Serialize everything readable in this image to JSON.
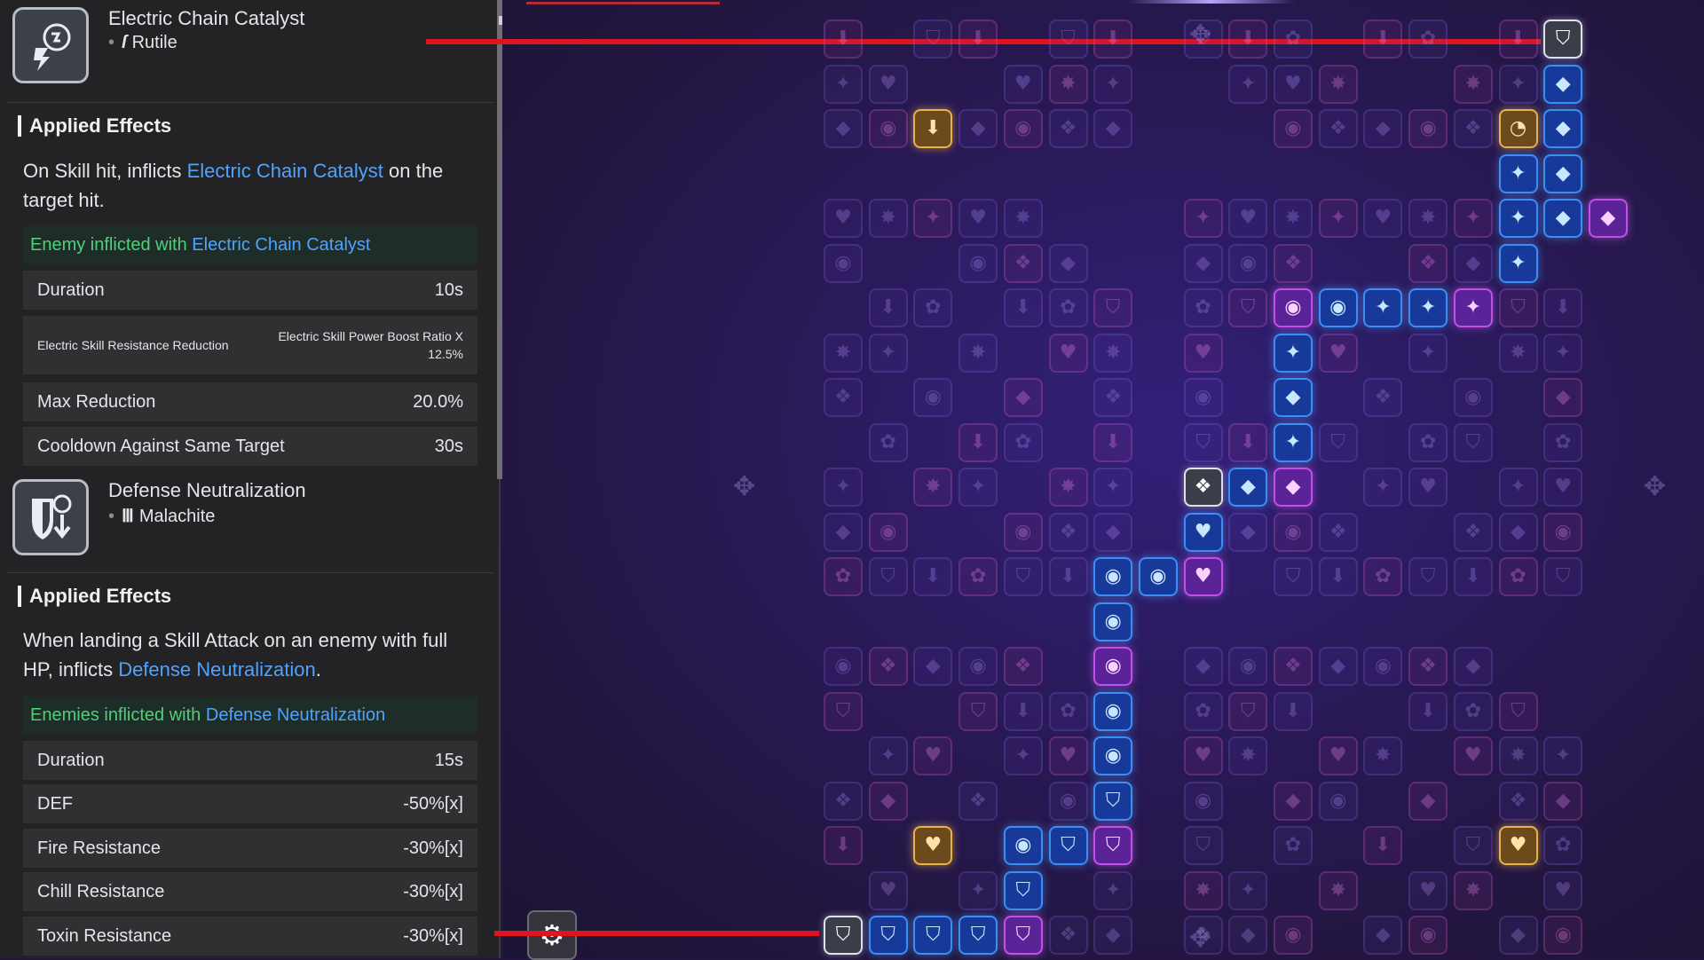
{
  "skills": [
    {
      "title": "Electric Chain Catalyst",
      "material": "Rutile",
      "section_title": "Applied Effects",
      "desc_prefix": "On Skill hit, inflicts ",
      "desc_link": "Electric Chain Catalyst",
      "desc_suffix": " on the target hit.",
      "enemy_prefix": "Enemy inflicted with ",
      "enemy_link": "Electric Chain Catalyst",
      "stats": [
        {
          "label": "Duration",
          "value": "10s"
        },
        {
          "label": "Electric Skill Resistance Reduction",
          "value": "Electric Skill Power Boost Ratio X 12.5%"
        },
        {
          "label": "Max Reduction",
          "value": "20.0%"
        },
        {
          "label": "Cooldown Against Same Target",
          "value": "30s"
        }
      ]
    },
    {
      "title": "Defense Neutralization",
      "material": "Malachite",
      "section_title": "Applied Effects",
      "desc_prefix": "When landing a Skill Attack on an enemy with full HP, inflicts ",
      "desc_link": "Defense Neutralization",
      "desc_suffix": ".",
      "enemy_prefix": "Enemies inflicted with ",
      "enemy_link": "Defense Neutralization",
      "stats": [
        {
          "label": "Duration",
          "value": "15s"
        },
        {
          "label": "DEF",
          "value": "-50%[x]"
        },
        {
          "label": "Fire Resistance",
          "value": "-30%[x]"
        },
        {
          "label": "Chill Resistance",
          "value": "-30%[x]"
        },
        {
          "label": "Toxin Resistance",
          "value": "-30%[x]"
        }
      ]
    }
  ],
  "colors": {
    "accent_blue": "#4fa3ff",
    "enemy_green": "#4ed07a",
    "active_blue": "#3d8df2",
    "active_purple": "#c24fe8",
    "active_gold": "#e7b24b",
    "pointer_red": "#e0141c"
  },
  "icons": {
    "skill_1": "electric-chain-catalyst-icon",
    "skill_2": "defense-neutralization-icon",
    "material_1": "rutile-icon",
    "material_2": "malachite-icon",
    "settings": "gear-icon"
  }
}
